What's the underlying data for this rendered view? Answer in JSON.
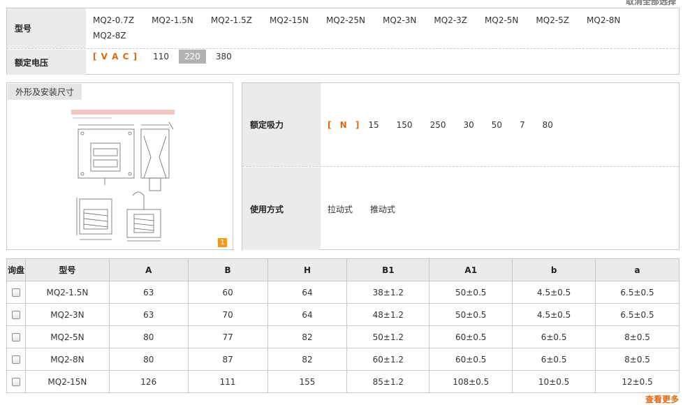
{
  "top_action": "取消全部选择",
  "filters": {
    "model": {
      "label": "型号",
      "options": [
        "MQ2-0.7Z",
        "MQ2-1.5N",
        "MQ2-1.5Z",
        "MQ2-15N",
        "MQ2-25N",
        "MQ2-3N",
        "MQ2-3Z",
        "MQ2-5N",
        "MQ2-5Z",
        "MQ2-8N",
        "MQ2-8Z"
      ]
    },
    "voltage": {
      "label": "额定电压",
      "unit": "[ V A C ]",
      "options": [
        "110",
        "220",
        "380"
      ],
      "selected": "220"
    }
  },
  "image_panel": {
    "tab": "外形及安装尺寸",
    "page_badge": "1"
  },
  "specs": {
    "force": {
      "label": "额定吸力",
      "unit": "[ N ]",
      "options": [
        "15",
        "150",
        "250",
        "30",
        "50",
        "7",
        "80"
      ]
    },
    "usage": {
      "label": "使用方式",
      "options": [
        "拉动式",
        "推动式"
      ]
    }
  },
  "table": {
    "headers": [
      "询盘",
      "型号",
      "A",
      "B",
      "H",
      "B1",
      "A1",
      "b",
      "a"
    ],
    "rows": [
      [
        "MQ2-1.5N",
        "63",
        "60",
        "64",
        "38±1.2",
        "50±0.5",
        "4.5±0.5",
        "6.5±0.5"
      ],
      [
        "MQ2-3N",
        "63",
        "70",
        "64",
        "48±1.2",
        "50±0.5",
        "4.5±0.5",
        "6.5±0.5"
      ],
      [
        "MQ2-5N",
        "80",
        "77",
        "82",
        "50±1.2",
        "60±0.5",
        "6±0.5",
        "8±0.5"
      ],
      [
        "MQ2-8N",
        "80",
        "87",
        "82",
        "60±1.2",
        "60±0.5",
        "6±0.5",
        "8±0.5"
      ],
      [
        "MQ2-15N",
        "126",
        "111",
        "155",
        "85±1.2",
        "108±0.5",
        "10±0.5",
        "12±0.5"
      ]
    ]
  },
  "more_link": "查看更多",
  "colors": {
    "accent": "#e06a12",
    "label_bg": "#ebebeb",
    "border": "#c8c8c8"
  }
}
